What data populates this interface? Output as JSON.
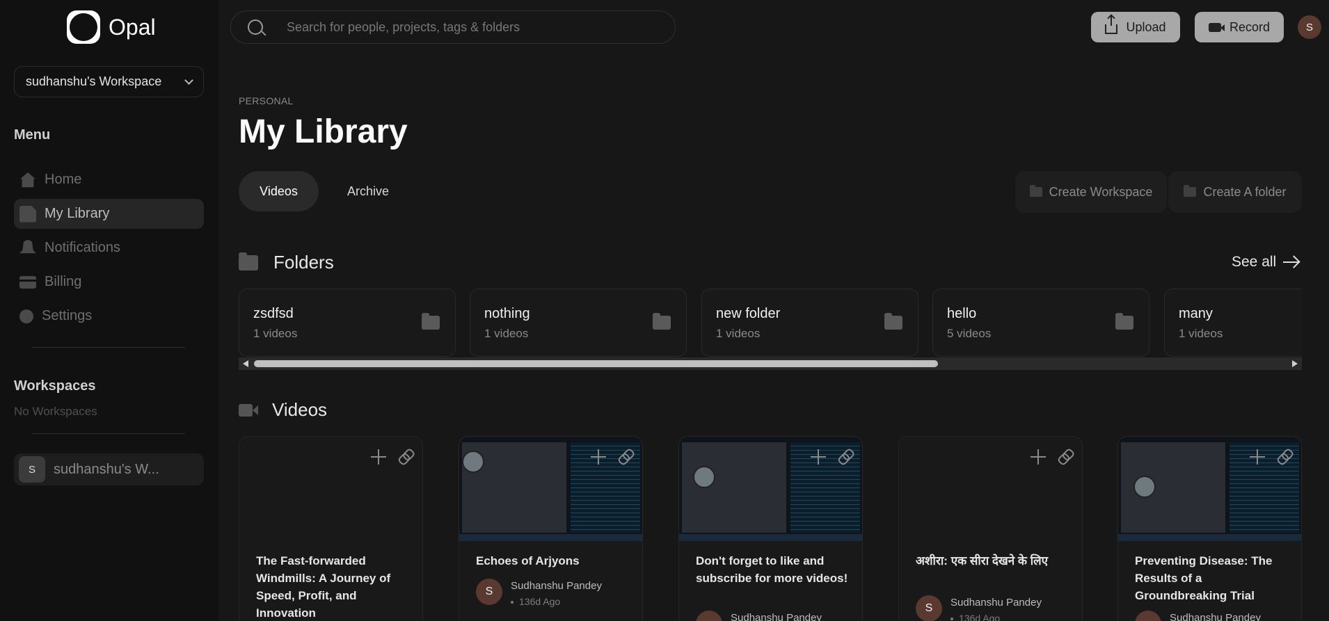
{
  "app": {
    "name": "Opal"
  },
  "sidebar": {
    "workspace_select": "sudhanshu's Workspace",
    "menu_title": "Menu",
    "items": [
      {
        "label": "Home",
        "icon": "home-icon",
        "active": false
      },
      {
        "label": "My Library",
        "icon": "library-icon",
        "active": true
      },
      {
        "label": "Notifications",
        "icon": "bell-icon",
        "active": false
      },
      {
        "label": "Billing",
        "icon": "credit-card-icon",
        "active": false
      },
      {
        "label": "Settings",
        "icon": "gear-icon",
        "active": false
      }
    ],
    "workspaces_title": "Workspaces",
    "workspaces_empty": "No Workspaces",
    "user_workspace": {
      "initial": "S",
      "label": "sudhanshu's W..."
    }
  },
  "topbar": {
    "search_placeholder": "Search for people, projects, tags & folders",
    "upload_label": "Upload",
    "record_label": "Record",
    "avatar_initial": "S"
  },
  "header": {
    "eyebrow": "PERSONAL",
    "title": "My Library",
    "tabs": [
      {
        "label": "Videos",
        "active": true
      },
      {
        "label": "Archive",
        "active": false
      }
    ],
    "create_workspace_label": "Create Workspace",
    "create_folder_label": "Create A folder"
  },
  "folders": {
    "title": "Folders",
    "see_all_label": "See all",
    "items": [
      {
        "name": "zsdfsd",
        "count": "1 videos"
      },
      {
        "name": "nothing",
        "count": "1 videos"
      },
      {
        "name": "new folder",
        "count": "1 videos"
      },
      {
        "name": "hello",
        "count": "5 videos"
      },
      {
        "name": "many",
        "count": "1 videos"
      }
    ]
  },
  "videos": {
    "title": "Videos",
    "items": [
      {
        "title": "The Fast-forwarded Windmills: A Journey of Speed, Profit, and Innovation",
        "author": "",
        "ago": "",
        "initial": "",
        "thumbnail": "empty"
      },
      {
        "title": "Echoes of Arjyons",
        "author": "Sudhanshu Pandey",
        "ago": "136d Ago",
        "initial": "S",
        "thumbnail": "screenshot"
      },
      {
        "title": "Don't forget to like and subscribe for more videos!",
        "author": "Sudhanshu Pandey",
        "ago": "",
        "initial": "",
        "thumbnail": "screenshot"
      },
      {
        "title": "अशीरा: एक सीरा देखने के लिए",
        "author": "Sudhanshu Pandey",
        "ago": "136d Ago",
        "initial": "S",
        "thumbnail": "empty"
      },
      {
        "title": "Preventing Disease: The Results of a Groundbreaking Trial",
        "author": "Sudhanshu Pandey",
        "ago": "",
        "initial": "",
        "thumbnail": "screenshot"
      }
    ]
  }
}
